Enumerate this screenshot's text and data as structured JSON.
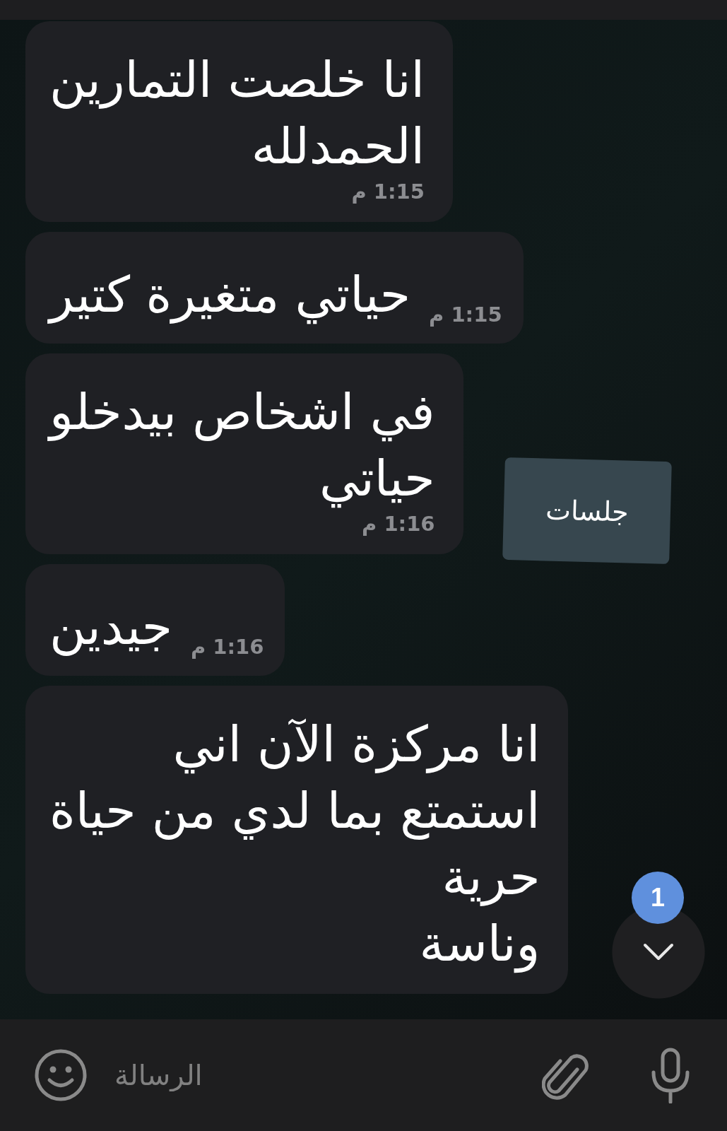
{
  "messages": [
    {
      "text": "انا خلصت التمارين\nالحمدلله",
      "time": "1:15 م"
    },
    {
      "text": "حياتي متغيرة كتير",
      "time": "1:15 م"
    },
    {
      "text": "في اشخاص بيدخلو\nحياتي",
      "time": "1:16 م"
    },
    {
      "text": "جيدين",
      "time": "1:16 م"
    },
    {
      "text": "انا مركزة الآن اني\nاستمتع بما لدي من حياة\nحرية\nوناسة"
    }
  ],
  "floating_label": "جلسات",
  "scroll_down_button": {
    "unread_count": "1"
  },
  "composer": {
    "placeholder": "الرسالة"
  }
}
